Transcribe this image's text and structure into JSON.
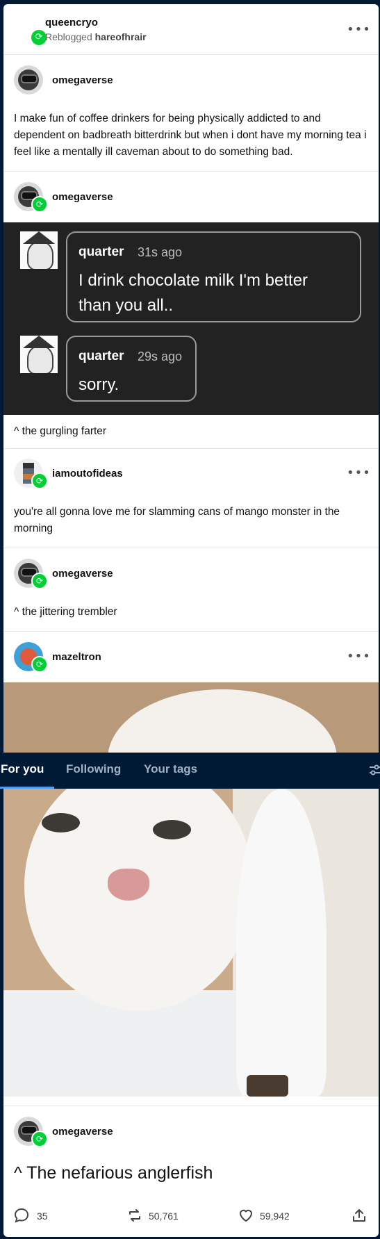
{
  "post": {
    "header": {
      "username": "queencryo",
      "reblogged_prefix": "Reblogged",
      "reblogged_from": "hareofhrair"
    },
    "trail": [
      {
        "username": "omegaverse",
        "text": "I make fun of coffee drinkers for being physically addicted to and dependent on badbreath bitterdrink but when i dont have my morning tea i feel like a mentally ill caveman about to do something bad."
      },
      {
        "username": "omegaverse",
        "text": "^ the gurgling farter"
      },
      {
        "username": "iamoutofideas",
        "text": "you're all gonna love me for slamming cans of mango monster in the morning"
      },
      {
        "username": "omegaverse",
        "text": "^ the jittering trembler"
      },
      {
        "username": "mazeltron"
      },
      {
        "username": "omegaverse",
        "text": "^ The nefarious anglerfish"
      }
    ],
    "chat": [
      {
        "name": "quarter",
        "time": "31s ago",
        "text": "I drink chocolate milk I'm better than you all.."
      },
      {
        "name": "quarter",
        "time": "29s ago",
        "text": "sorry."
      }
    ],
    "footer": {
      "replies": "35",
      "reblogs": "50,761",
      "likes": "59,942"
    }
  },
  "tabs": {
    "for_you": "For you",
    "following": "Following",
    "your_tags": "Your tags"
  },
  "colors": {
    "reblog_green": "#00cf35",
    "nav_bg": "#001935",
    "chat_bg": "#222222"
  },
  "icons": [
    "reblog-icon",
    "more-icon",
    "reply-icon",
    "like-icon",
    "share-icon",
    "filter-icon"
  ]
}
